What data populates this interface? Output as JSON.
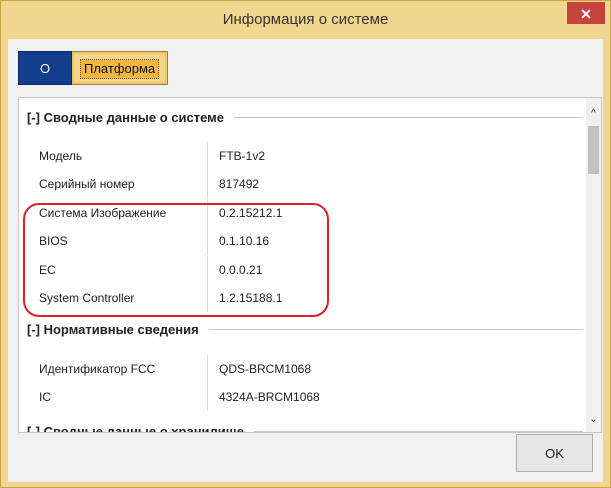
{
  "window": {
    "title": "Информация о системе",
    "close_glyph": "✕"
  },
  "tabs": [
    {
      "label": "О",
      "active": true
    },
    {
      "label": "Платформа",
      "active": false
    }
  ],
  "sections": [
    {
      "title": "[-] Сводные данные о системе",
      "rows": [
        {
          "label": "Модель",
          "value": "FTB-1v2"
        },
        {
          "label": "Серийный номер",
          "value": "817492"
        },
        {
          "label": "Система Изображение",
          "value": "0.2.15212.1"
        },
        {
          "label": "BIOS",
          "value": "0.1.10.16"
        },
        {
          "label": "EC",
          "value": "0.0.0.21"
        },
        {
          "label": "System Controller",
          "value": "1.2.15188.1"
        }
      ]
    },
    {
      "title": "[-] Нормативные сведения",
      "rows": [
        {
          "label": "Идентификатор FCC",
          "value": "QDS-BRCM1068"
        },
        {
          "label": "IC",
          "value": "4324A-BRCM1068"
        }
      ]
    },
    {
      "title": "[-] Сводные данные о хранилище",
      "rows": []
    }
  ],
  "scroll": {
    "up_glyph": "^",
    "down_glyph": "⌄"
  },
  "footer": {
    "ok_label": "OK"
  },
  "colors": {
    "accent_frame": "#f0d68e",
    "tab_active": "#123d8c",
    "highlight": "#e0202a",
    "close": "#c7423f"
  }
}
